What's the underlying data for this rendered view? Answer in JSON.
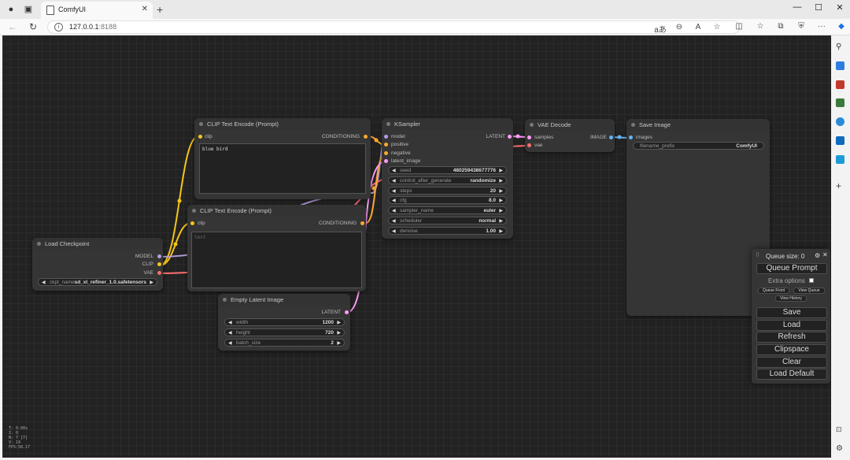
{
  "browser": {
    "tab_title": "ComfyUI",
    "url_host": "127.0.0.1",
    "url_port": ":8188"
  },
  "nodes": {
    "clip_encode_1": {
      "title": "CLIP Text Encode (Prompt)",
      "input": "clip",
      "output": "CONDITIONING",
      "text": "blue bird"
    },
    "clip_encode_2": {
      "title": "CLIP Text Encode (Prompt)",
      "input": "clip",
      "output": "CONDITIONING",
      "placeholder": "text"
    },
    "load_checkpoint": {
      "title": "Load Checkpoint",
      "outputs": [
        "MODEL",
        "CLIP",
        "VAE"
      ],
      "ckpt_label": "ckpt_name",
      "ckpt_value": "sd_xl_refiner_1.0.safetensors"
    },
    "empty_latent": {
      "title": "Empty Latent Image",
      "output": "LATENT",
      "widgets": [
        {
          "label": "width",
          "value": "1200"
        },
        {
          "label": "height",
          "value": "720"
        },
        {
          "label": "batch_size",
          "value": "2"
        }
      ]
    },
    "ksampler": {
      "title": "KSampler",
      "inputs": [
        "model",
        "positive",
        "negative",
        "latent_image"
      ],
      "output": "LATENT",
      "widgets": [
        {
          "label": "seed",
          "value": "480259438677776"
        },
        {
          "label": "control_after_generate",
          "value": "randomize"
        },
        {
          "label": "steps",
          "value": "20"
        },
        {
          "label": "cfg",
          "value": "8.0"
        },
        {
          "label": "sampler_name",
          "value": "euler"
        },
        {
          "label": "scheduler",
          "value": "normal"
        },
        {
          "label": "denoise",
          "value": "1.00"
        }
      ]
    },
    "vae_decode": {
      "title": "VAE Decode",
      "inputs": [
        "samples",
        "vae"
      ],
      "output": "IMAGE"
    },
    "save_image": {
      "title": "Save Image",
      "input": "images",
      "widget_label": "filename_prefix",
      "widget_value": "ComfyUI"
    }
  },
  "menu": {
    "queue_size": "Queue size: 0",
    "queue_prompt": "Queue Prompt",
    "extra_options": "Extra options",
    "queue_front": "Queue Front",
    "view_queue": "View Queue",
    "view_history": "View History",
    "save": "Save",
    "load": "Load",
    "refresh": "Refresh",
    "clipspace": "Clipspace",
    "clear": "Clear",
    "load_default": "Load Default"
  },
  "stats": [
    "T: 0.00s",
    "I: 0",
    "N: 7 [7]",
    "V: 14",
    "FPS:58.17"
  ],
  "colors": {
    "clip": "#f5c518",
    "model": "#b39ddb",
    "conditioning": "#ffa931",
    "latent": "#ff9cf9",
    "vae": "#ff6e6e",
    "image": "#64b5f6",
    "canvas": "#222222",
    "node": "#353535"
  }
}
